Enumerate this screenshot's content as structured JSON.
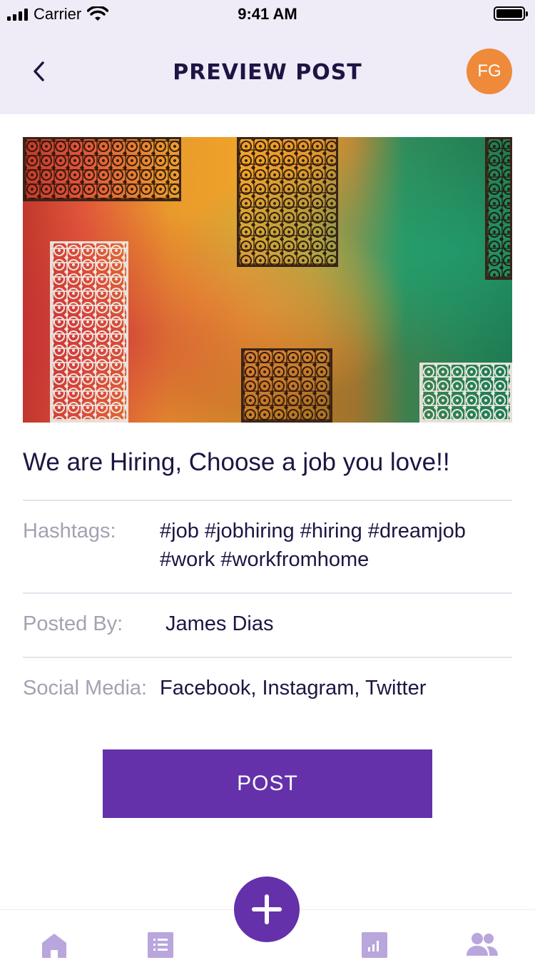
{
  "status_bar": {
    "carrier": "Carrier",
    "time": "9:41 AM"
  },
  "header": {
    "title": "PREVIEW POST",
    "avatar_initials": "FG",
    "avatar_color": "#ee8a3a"
  },
  "post": {
    "title": "We are Hiring, Choose a job you love!!",
    "details": [
      {
        "label": "Hashtags:",
        "value_lines": [
          "#job #jobhiring #hiring #dreamjob",
          "#work #workfromhome"
        ]
      },
      {
        "label": "Posted By:",
        "value": "James Dias"
      },
      {
        "label": "Social Media:",
        "value": "Facebook, Instagram, Twitter"
      }
    ]
  },
  "actions": {
    "post_label": "POST"
  },
  "tab_bar": {
    "tabs": [
      "home-icon",
      "list-icon",
      "add-icon",
      "chart-icon",
      "people-icon"
    ],
    "accent_color": "#6431ab",
    "icon_color": "#b8a6dc"
  }
}
